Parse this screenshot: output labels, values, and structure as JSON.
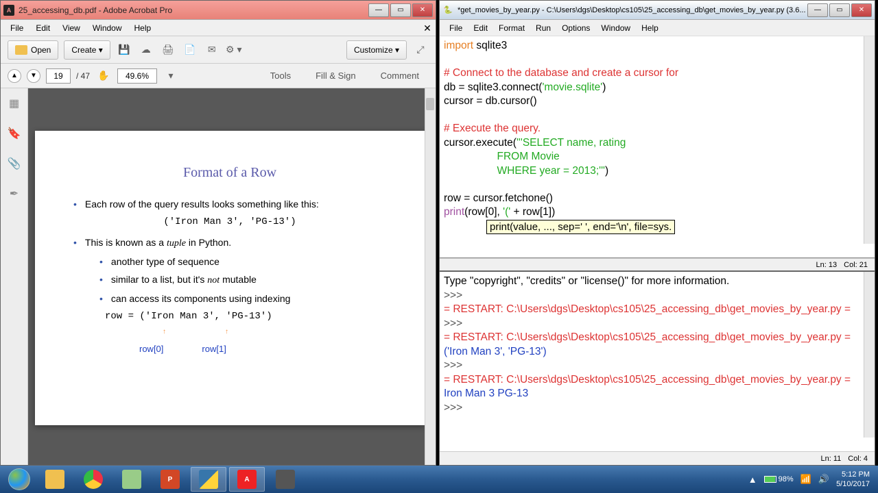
{
  "acrobat": {
    "title": "25_accessing_db.pdf - Adobe Acrobat Pro",
    "menu": [
      "File",
      "Edit",
      "View",
      "Window",
      "Help"
    ],
    "toolbar": {
      "open": "Open",
      "create": "Create ▾",
      "customize": "Customize ▾"
    },
    "nav": {
      "page": "19",
      "totalPages": "/ 47",
      "zoom": "49.6%"
    },
    "rightTabs": {
      "tools": "Tools",
      "fillSign": "Fill & Sign",
      "comment": "Comment"
    },
    "pdf": {
      "heading": "Format of a Row",
      "b1": "Each row of the query results looks something like this:",
      "code1": "('Iron Man 3', 'PG-13')",
      "b2a": "This is known as a ",
      "b2b": "tuple",
      "b2c": " in Python.",
      "s1": "another type of sequence",
      "s2a": "similar to a list, but it's ",
      "s2b": "not",
      "s2c": " mutable",
      "s3": "can access its components using indexing",
      "code2": "row = ('Iron Man 3', 'PG-13')",
      "idx0": "row[0]",
      "idx1": "row[1]"
    }
  },
  "idle": {
    "editorTitle": "*get_movies_by_year.py - C:\\Users\\dgs\\Desktop\\cs105\\25_accessing_db\\get_movies_by_year.py (3.6...",
    "menu": [
      "File",
      "Edit",
      "Format",
      "Run",
      "Options",
      "Window",
      "Help"
    ],
    "editorStatus": {
      "ln": "Ln: 13",
      "col": "Col: 21"
    },
    "code": {
      "l1a": "import",
      "l1b": " sqlite3",
      "l3": "# Connect to the database and create a cursor for",
      "l4a": "db = sqlite3.connect(",
      "l4b": "'movie.sqlite'",
      "l4c": ")",
      "l5": "cursor = db.cursor()",
      "l7": "# Execute the query.",
      "l8a": "cursor.execute(",
      "l8b": "'''SELECT name, rating",
      "l9": "                  FROM Movie",
      "l10a": "                  WHERE year = 2013;'''",
      "l10b": ")",
      "l12": "row = cursor.fetchone()",
      "l13a": "print",
      "l13b": "(row[0], ",
      "l13c": "'('",
      "l13d": " + row[1])",
      "tooltip": "print(value, ..., sep=' ', end='\\n', file=sys."
    },
    "shell": {
      "l1": "Type \"copyright\", \"credits\" or \"license()\" for more information.",
      "prompt": ">>> ",
      "r1": "= RESTART: C:\\Users\\dgs\\Desktop\\cs105\\25_accessing_db\\get_movies_by_year.py =",
      "out1": "('Iron Man 3', 'PG-13')",
      "out2": "Iron Man 3 PG-13"
    },
    "shellStatus": {
      "ln": "Ln: 11",
      "col": "Col: 4"
    }
  },
  "taskbar": {
    "battery": "98%",
    "time": "5:12 PM",
    "date": "5/10/2017"
  }
}
